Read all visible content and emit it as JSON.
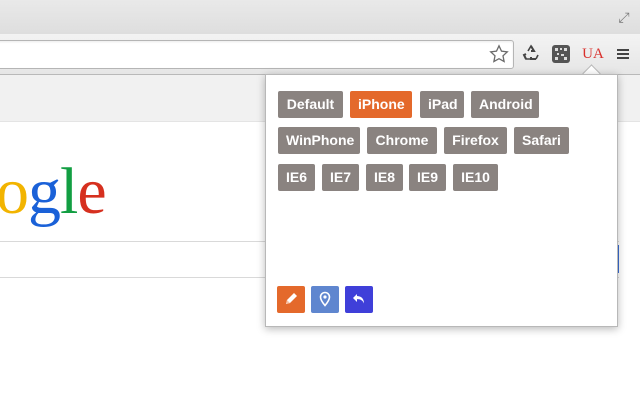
{
  "browser": {
    "extensions": {
      "ua_label": "UA"
    }
  },
  "page": {
    "logo_text": [
      "o",
      "g",
      "l",
      "e"
    ]
  },
  "popup": {
    "rows": [
      [
        {
          "label": "Default",
          "active": false
        },
        {
          "label": "iPhone",
          "active": true
        },
        {
          "label": "iPad",
          "active": false
        },
        {
          "label": "Android",
          "active": false
        }
      ],
      [
        {
          "label": "WinPhone",
          "active": false
        },
        {
          "label": "Chrome",
          "active": false
        },
        {
          "label": "Firefox",
          "active": false
        },
        {
          "label": "Safari",
          "active": false
        }
      ],
      [
        {
          "label": "IE6",
          "active": false
        },
        {
          "label": "IE7",
          "active": false
        },
        {
          "label": "IE8",
          "active": false
        },
        {
          "label": "IE9",
          "active": false
        },
        {
          "label": "IE10",
          "active": false
        }
      ]
    ],
    "tools": [
      {
        "icon": "pencil-icon"
      },
      {
        "icon": "map-pin-icon"
      },
      {
        "icon": "undo-arrow-icon"
      }
    ],
    "colors": {
      "button": "#8a8380",
      "active": "#e4692b",
      "edit": "#e4692b",
      "pin": "#5f86cf",
      "back": "#3f3fd9"
    }
  }
}
